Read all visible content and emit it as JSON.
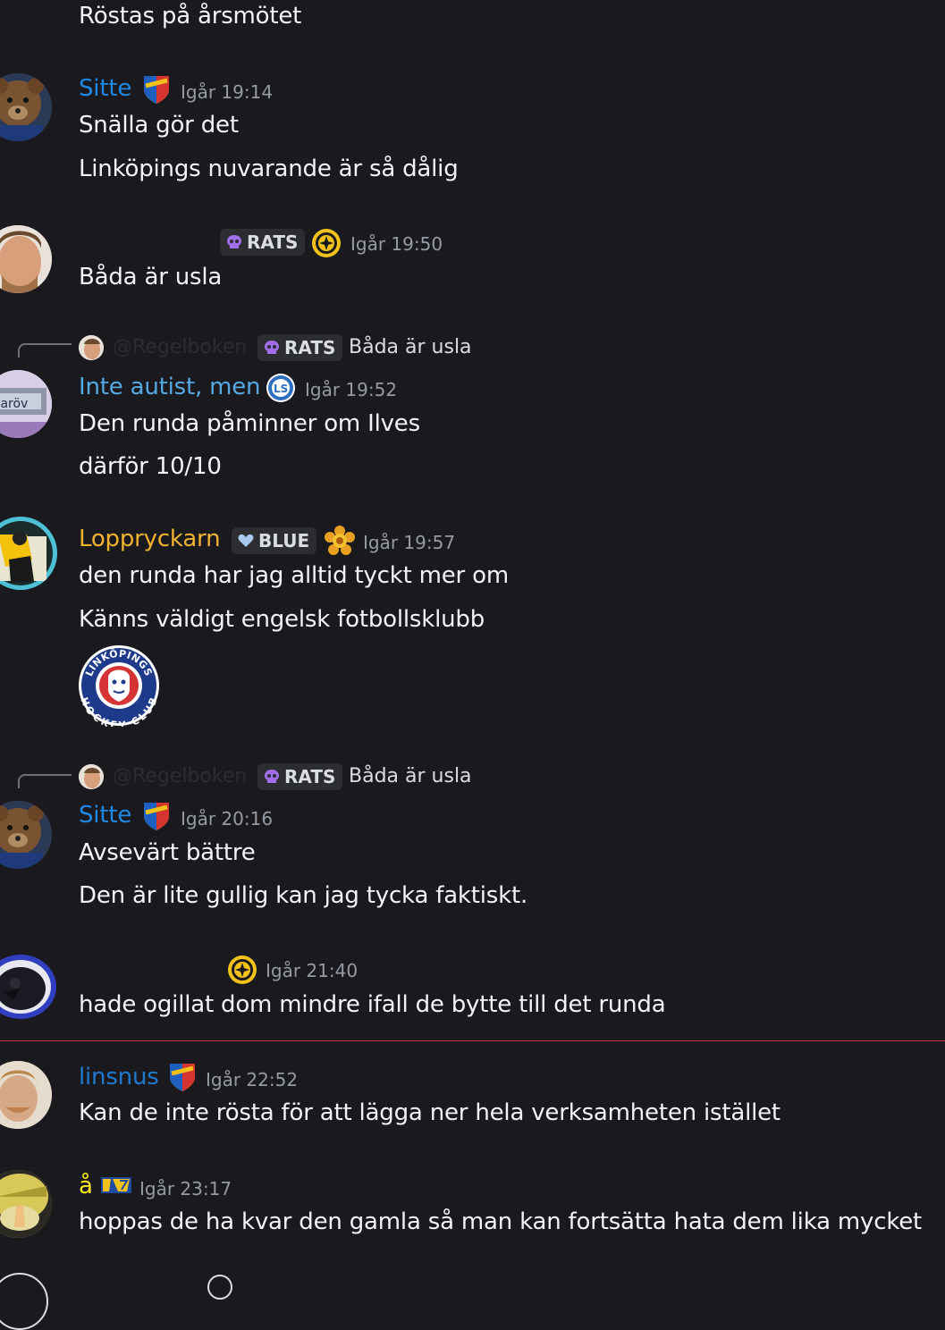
{
  "colors": {
    "background": "#1a1a1e",
    "text": "#f2f3f5",
    "timestamp": "#949ba4",
    "sitte": "#1e88e5",
    "inte": "#55a9e3",
    "loppryckarn": "#f1b131",
    "linsnus": "#1e79cf",
    "a_user": "#f8e71c",
    "regelboken": "#19191c",
    "new_divider": "#d0343b"
  },
  "top_message": {
    "text": "Röstas på årsmötet"
  },
  "messages": [
    {
      "username": "Sitte",
      "timestamp": "Igår 19:14",
      "lines": [
        "Snälla gör det",
        "Linköpings nuvarande är så dålig"
      ],
      "badge_icon": "djurgarden-shield-icon"
    },
    {
      "username": "Regelboken",
      "tag": "RATS",
      "timestamp": "Igår 19:50",
      "lines": [
        "Båda är usla"
      ],
      "badge_icon": "brynas-crest-icon"
    },
    {
      "reply": {
        "mention": "@Regelboken",
        "tag": "RATS",
        "text": "Båda är usla"
      },
      "username": "Inte autist, men",
      "timestamp": "Igår 19:52",
      "lines": [
        "Den runda påminner om Ilves",
        "därför 10/10"
      ],
      "badge_icon": "leksand-crest-icon"
    },
    {
      "username": "Loppryckarn",
      "tag": "BLUE",
      "timestamp": "Igår 19:57",
      "lines": [
        "den runda har jag alltid tyckt mer om",
        "Känns väldigt engelsk fotbollsklubb"
      ],
      "badge_icon": "flower-badge-icon",
      "attachment_logo_text": [
        "LINKÖPINGS",
        "HOCKEY CLUB"
      ]
    },
    {
      "reply": {
        "mention": "@Regelboken",
        "tag": "RATS",
        "text": "Båda är usla"
      },
      "username": "Sitte",
      "timestamp": "Igår 20:16",
      "lines": [
        "Avsevärt bättre",
        "Den är lite gullig kan jag tycka faktiskt."
      ],
      "badge_icon": "djurgarden-shield-icon"
    },
    {
      "username": "39003/4145",
      "timestamp": "Igår 21:40",
      "lines": [
        "hade ogillat dom mindre ifall de bytte till det runda"
      ],
      "badge_icon": "brynas-crest-icon"
    },
    {
      "username": "linsnus",
      "timestamp": "Igår 22:52",
      "lines": [
        "Kan de inte rösta för att lägga ner hela verksamheten istället"
      ],
      "badge_icon": "djurgarden-shield-icon"
    },
    {
      "username": "å",
      "timestamp": "Igår 23:17",
      "lines": [
        "hoppas de ha kvar den gamla så man kan fortsätta hata dem lika mycket"
      ],
      "badge_icon": "hv71-badge-icon"
    }
  ]
}
